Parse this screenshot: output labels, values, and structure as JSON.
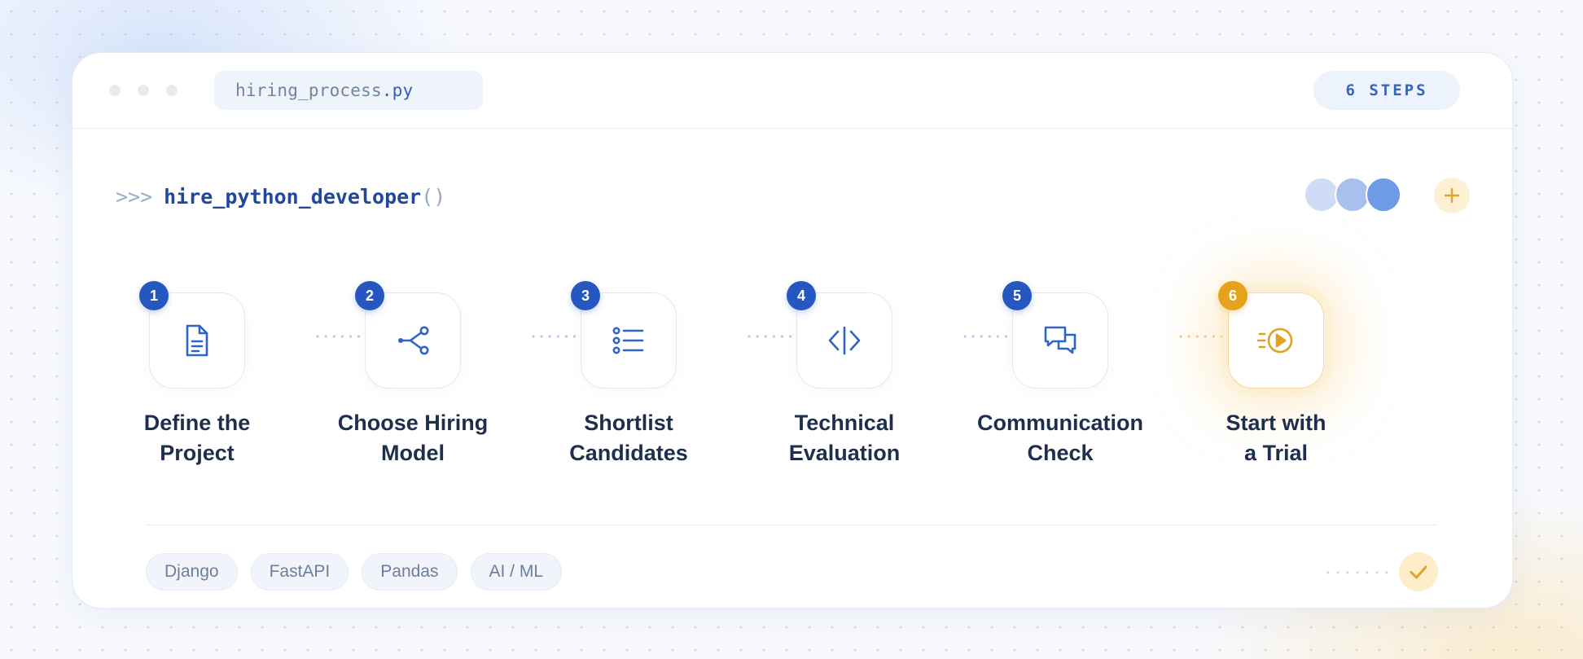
{
  "window": {
    "filename_stem": "hiring_process",
    "filename_ext": ".py",
    "steps_count_label": "6 STEPS"
  },
  "command": {
    "prompt": ">>>",
    "function_name": "hire_python_developer",
    "parens": "()"
  },
  "steps": [
    {
      "number": "1",
      "label_line1": "Define the",
      "label_line2": "Project",
      "icon": "document-icon"
    },
    {
      "number": "2",
      "label_line1": "Choose Hiring",
      "label_line2": "Model",
      "icon": "share-icon"
    },
    {
      "number": "3",
      "label_line1": "Shortlist",
      "label_line2": "Candidates",
      "icon": "list-icon"
    },
    {
      "number": "4",
      "label_line1": "Technical",
      "label_line2": "Evaluation",
      "icon": "code-icon"
    },
    {
      "number": "5",
      "label_line1": "Communication",
      "label_line2": "Check",
      "icon": "chat-icon"
    },
    {
      "number": "6",
      "label_line1": "Start with",
      "label_line2": "a Trial",
      "icon": "play-icon"
    }
  ],
  "tags": [
    "Django",
    "FastAPI",
    "Pandas",
    "AI / ML"
  ],
  "colors": {
    "primary": "#2657c1",
    "accent": "#e6a21b",
    "heading": "#1e2f4d"
  }
}
